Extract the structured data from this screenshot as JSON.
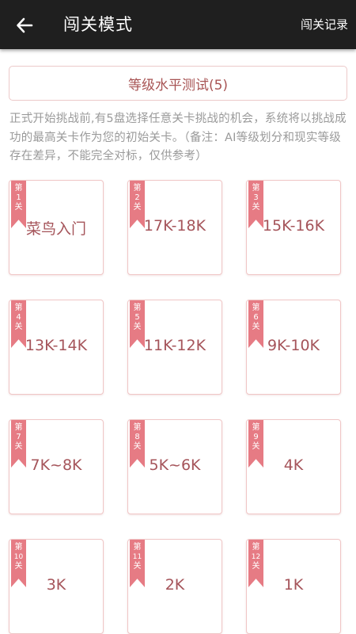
{
  "header": {
    "title": "闯关模式",
    "records_label": "闯关记录"
  },
  "test_button": {
    "label": "等级水平测试(5)"
  },
  "description": "正式开始挑战前,有5盘选择任意关卡挑战的机会，系统将以挑战成功的最高关卡作为您的初始关卡。（备注：AI等级划分和现实等级存在差异，不能完全对标，仅供参考）",
  "levels": [
    {
      "num_top": "第",
      "num": "1",
      "num_bottom": "关",
      "label": "菜鸟入门"
    },
    {
      "num_top": "第",
      "num": "2",
      "num_bottom": "关",
      "label": "17K-18K"
    },
    {
      "num_top": "第",
      "num": "3",
      "num_bottom": "关",
      "label": "15K-16K"
    },
    {
      "num_top": "第",
      "num": "4",
      "num_bottom": "关",
      "label": "13K-14K"
    },
    {
      "num_top": "第",
      "num": "5",
      "num_bottom": "关",
      "label": "11K-12K"
    },
    {
      "num_top": "第",
      "num": "6",
      "num_bottom": "关",
      "label": "9K-10K"
    },
    {
      "num_top": "第",
      "num": "7",
      "num_bottom": "关",
      "label": "7K~8K"
    },
    {
      "num_top": "第",
      "num": "8",
      "num_bottom": "关",
      "label": "5K~6K"
    },
    {
      "num_top": "第",
      "num": "9",
      "num_bottom": "关",
      "label": "4K"
    },
    {
      "num_top": "第",
      "num": "10",
      "num_bottom": "关",
      "label": "3K"
    },
    {
      "num_top": "第",
      "num": "11",
      "num_bottom": "关",
      "label": "2K"
    },
    {
      "num_top": "第",
      "num": "12",
      "num_bottom": "关",
      "label": "1K"
    }
  ],
  "colors": {
    "topbar": "#1f1f1f",
    "accent_text": "#a5545a",
    "ribbon": "#e67b84",
    "card_border": "#f0c6c6",
    "desc_text": "#9a9a9a"
  },
  "icons": {
    "back": "back-arrow-icon"
  }
}
